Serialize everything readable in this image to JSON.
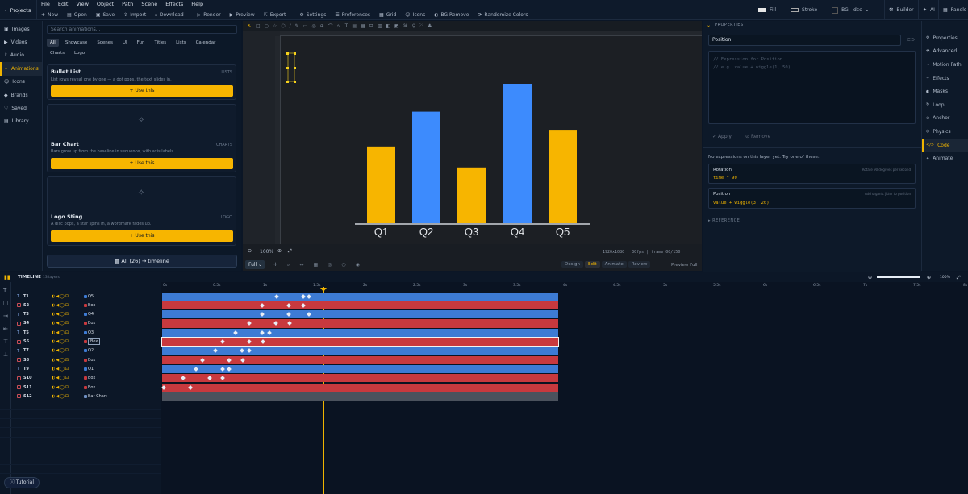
{
  "topbar": {
    "projects": "Projects",
    "menu": [
      "File",
      "Edit",
      "View",
      "Object",
      "Path",
      "Scene",
      "Effects",
      "Help"
    ],
    "tools": [
      "New",
      "Open",
      "Save",
      "Import",
      "Download",
      "Render",
      "Preview",
      "Export",
      "Settings",
      "Preferences",
      "Grid",
      "Icons",
      "BG Remove",
      "Randomize Colors"
    ],
    "fill": "Fill",
    "stroke": "Stroke",
    "bg": "BG",
    "doc": "dcc",
    "builder": "Builder",
    "ai": "AI",
    "panels": "Panels"
  },
  "sidebar": [
    "Images",
    "Videos",
    "Audio",
    "Animations",
    "Icons",
    "Brands",
    "Saved",
    "Library"
  ],
  "library": {
    "search_placeholder": "Search animations...",
    "chips": [
      "All",
      "Showcase",
      "Scenes",
      "UI",
      "Fun",
      "Titles",
      "Lists",
      "Calendar",
      "Charts",
      "Logo"
    ],
    "cards": [
      {
        "title": "Bullet List",
        "tag": "LISTS",
        "desc": "List rows reveal one by one — a dot pops, the text slides in.",
        "btn": "Use this"
      },
      {
        "title": "Bar Chart",
        "tag": "CHARTS",
        "desc": "Bars grow up from the baseline in sequence, with axis labels.",
        "btn": "Use this"
      },
      {
        "title": "Logo Sting",
        "tag": "LOGO",
        "desc": "A disc pops, a star spins in, a wordmark fades up.",
        "btn": "Use this"
      }
    ],
    "all": "All (26) → timeline"
  },
  "chart_data": {
    "type": "bar",
    "categories": [
      "Q1",
      "Q2",
      "Q3",
      "Q4",
      "Q5"
    ],
    "values": [
      55,
      80,
      40,
      100,
      67
    ],
    "colors": [
      "#f7b500",
      "#3d8bfd",
      "#f7b500",
      "#3d8bfd",
      "#f7b500"
    ]
  },
  "canvas": {
    "zoom": "100%",
    "status": "1920x1080 | 30fps | frame 00/150",
    "full": "Full",
    "modes": [
      "Design",
      "Edit",
      "Animate",
      "Review"
    ],
    "preview": "Preview Full"
  },
  "props": {
    "header": "PROPERTIES",
    "field": "Position",
    "code": [
      "// Expression for Position",
      "// e.g. value + wiggle(1, 50)"
    ],
    "apply": "Apply",
    "remove": "Remove",
    "note": "No expressions on this layer yet. Try one of these:",
    "examples": [
      {
        "name": "Rotation",
        "hint": "Rotate 90 degrees per second",
        "code": "time * 90"
      },
      {
        "name": "Position",
        "hint": "Add organic jitter to position",
        "code": "value + wiggle(3, 20)"
      }
    ],
    "reference": "REFERENCE"
  },
  "rnav": [
    "Properties",
    "Advanced",
    "Motion Path",
    "Effects",
    "Masks",
    "Loop",
    "Anchor",
    "Physics",
    "Code",
    "Animate"
  ],
  "timeline": {
    "title": "TIMELINE",
    "layers_count": "13 layers",
    "zoom": "100%",
    "ticks": [
      "0s",
      "0.5s",
      "1s",
      "1.5s",
      "2s",
      "2.5s",
      "3s",
      "3.5s",
      "4s",
      "4.5s",
      "5s",
      "5.5s",
      "6s",
      "6.5s",
      "7s",
      "7.5s",
      "8s"
    ],
    "rows": [
      {
        "n": "T1",
        "l": "Q5",
        "c": "blue"
      },
      {
        "n": "S2",
        "l": "Box",
        "c": "red"
      },
      {
        "n": "T3",
        "l": "Q4",
        "c": "blue"
      },
      {
        "n": "S4",
        "l": "Box",
        "c": "red"
      },
      {
        "n": "T5",
        "l": "Q3",
        "c": "blue"
      },
      {
        "n": "S6",
        "l": "Box",
        "c": "red"
      },
      {
        "n": "T7",
        "l": "Q2",
        "c": "blue"
      },
      {
        "n": "S8",
        "l": "Box",
        "c": "red"
      },
      {
        "n": "T9",
        "l": "Q1",
        "c": "blue"
      },
      {
        "n": "S10",
        "l": "Box",
        "c": "red"
      },
      {
        "n": "S11",
        "l": "Box",
        "c": "red"
      },
      {
        "n": "S12",
        "l": "Bar Chart",
        "c": "gray"
      }
    ],
    "tutorial": "Tutorial"
  }
}
